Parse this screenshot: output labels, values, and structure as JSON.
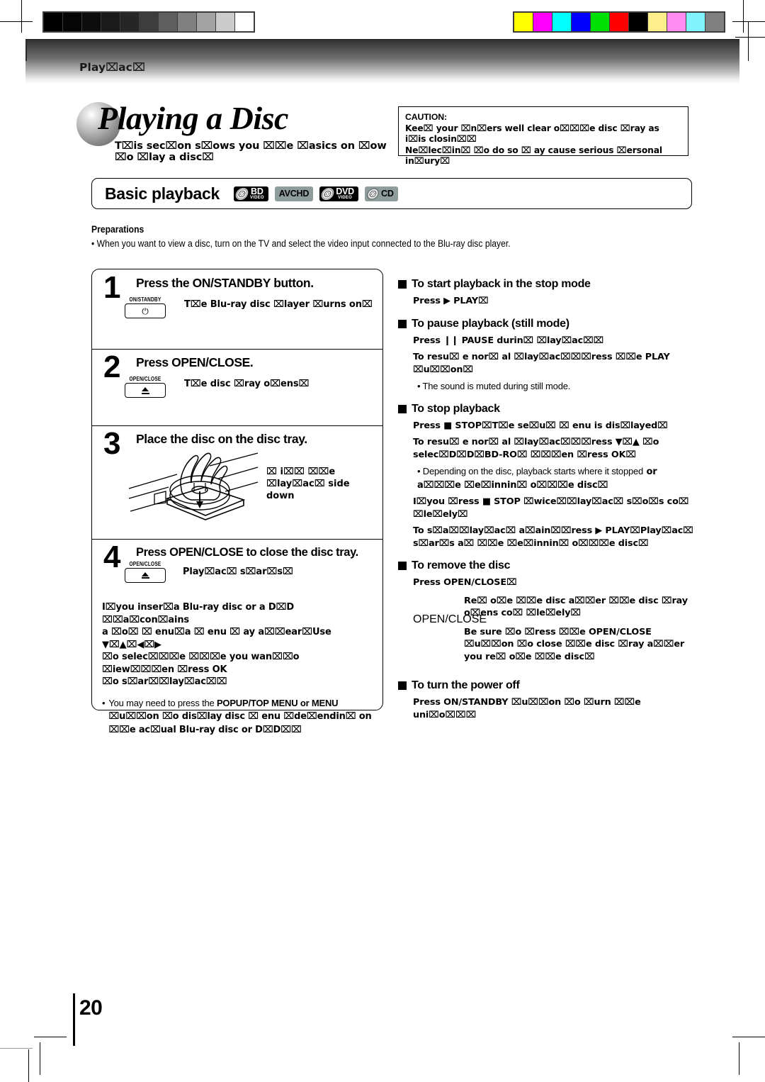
{
  "document": {
    "page_number": "20",
    "running_head": "Play⌧ac⌧"
  },
  "calibration": {
    "grayscale_patches": [
      "#000000",
      "#050505",
      "#0d0d0d",
      "#1a1a1a",
      "#262626",
      "#3d3d3d",
      "#5e5e5e",
      "#808080",
      "#a3a3a3",
      "#cccccc",
      "#ffffff"
    ],
    "color_patches": [
      "#ffff00",
      "#ff00ff",
      "#00ffff",
      "#0000ff",
      "#00e000",
      "#ff0000",
      "#000000",
      "#ffef8a",
      "#ff8cf0",
      "#80f5ff",
      "#808080"
    ]
  },
  "title": {
    "main": "Playing a Disc",
    "subtitle": "T⌧is sec⌧on s⌧ows you ⌧⌧e ⌧asics on ⌧ow ⌧o ⌧lay a disc⌧"
  },
  "caution": {
    "label": "CAUTION:",
    "line1": "Kee⌧ your ⌧n⌧ers well clear o⌧⌧⌧e disc ⌧ray as i⌧is closin⌧⌧",
    "line2": "Ne⌧lec⌧in⌧ ⌧o do so ⌧ ay cause serious ⌧ersonal in⌧ury⌧"
  },
  "banner": {
    "title": "Basic playback",
    "badges": [
      {
        "type": "disc",
        "name": "BD",
        "sub": "Video",
        "style": "dark"
      },
      {
        "type": "flat",
        "name": "AVCHD",
        "sub": "",
        "style": "gray"
      },
      {
        "type": "disc",
        "name": "DVD",
        "sub": "Video",
        "style": "dark"
      },
      {
        "type": "disc",
        "name": "CD",
        "sub": "",
        "style": "gray"
      }
    ]
  },
  "preparations": {
    "heading": "Preparations",
    "bullet": "• When you want to view a disc, turn on the TV and select the video input connected to the Blu-ray disc player."
  },
  "steps": [
    {
      "number": "1",
      "heading": "Press the ON/STANDBY button.",
      "key_label": "ON/STANDBY",
      "key_icon": "power-icon",
      "text": "T⌧e Blu-ray disc ⌧layer ⌧urns on⌧"
    },
    {
      "number": "2",
      "heading": "Press OPEN/CLOSE.",
      "key_label": "OPEN/CLOSE",
      "key_icon": "eject-icon",
      "text": "T⌧e disc ⌧ray o⌧ens⌧"
    },
    {
      "number": "3",
      "heading": "Place the disc on the disc tray.",
      "figure": "hand-placing-disc-on-tray-illustration",
      "fig_line1": "⌧ i⌧⌧ ⌧⌧e ⌧lay⌧ac⌧ side",
      "fig_line2": "down"
    },
    {
      "number": "4",
      "heading": "Press OPEN/CLOSE to close the disc tray.",
      "key_label": "OPEN/CLOSE",
      "key_icon": "eject-icon",
      "text": "Play⌧ac⌧ s⌧ar⌧s⌧",
      "note_line1": "I⌧you inser⌧a Blu-ray disc or a D⌧D ⌧⌧a⌧con⌧ains",
      "note_line2": "a ⌧o⌧ ⌧ enu⌧a ⌧ enu ⌧ ay a⌧⌧ear⌧Use",
      "note_arrows": "▼⌧▲⌧◀⌧▶",
      "note_line3": "⌧o selec⌧⌧⌧e ⌧⌧⌧e you wan⌧⌧o ⌧iew⌧⌧⌧en ⌧ress OK",
      "note_line4": "⌧o s⌧ar⌧⌧lay⌧ac⌧⌧",
      "bullet_a": "You may need to press the ",
      "bullet_b": "POPUP/TOP MENU or MENU",
      "bullet_c": " ⌧u⌧⌧on ⌧o dis⌧lay disc ⌧ enu ⌧de⌧endin⌧ on ⌧⌧e ac⌧ual Blu-ray disc or D⌧D⌧⌧"
    }
  ],
  "right_sections": [
    {
      "heading": "To start playback in the stop mode",
      "lines": [
        {
          "kind": "bold",
          "text": "Press  ▶ PLAY⌧"
        }
      ]
    },
    {
      "heading": "To pause playback (still mode)",
      "lines": [
        {
          "kind": "bold",
          "text": "Press  ❙❙ PAUSE durin⌧ ⌧lay⌧ac⌧⌧"
        },
        {
          "kind": "bold",
          "text": "To resu⌧ e nor⌧ al ⌧lay⌧ac⌧⌧⌧ress ⌧⌧e PLAY ⌧u⌧⌧on⌧"
        },
        {
          "kind": "bullet",
          "text": "• The sound is muted during still mode."
        }
      ]
    },
    {
      "heading": "To stop playback",
      "lines": [
        {
          "kind": "bold",
          "text": "Press  ■ STOP⌧T⌧e se⌧u⌧ ⌧ enu is dis⌧layed⌧"
        },
        {
          "kind": "bold",
          "text": "To resu⌧ e nor⌧ al ⌧lay⌧ac⌧⌧⌧ress  ▼⌧▲ ⌧o selec⌧D⌧D⌧BD-RO⌧ ⌧⌧⌧en ⌧ress OK⌧"
        },
        {
          "kind": "bullet-mixed",
          "normal": "• Depending on the disc, playback starts where it stopped",
          "bold": "or a⌧⌧⌧e ⌧e⌧innin⌧ o⌧⌧⌧e disc⌧"
        },
        {
          "kind": "bold",
          "text": "I⌧you ⌧ress  ■ STOP ⌧wice⌧⌧lay⌧ac⌧ s⌧o⌧s co⌧ ⌧le⌧ely⌧"
        },
        {
          "kind": "bold",
          "text": "To s⌧a⌧⌧lay⌧ac⌧ a⌧ain⌧⌧ress ▶ PLAY⌧Play⌧ac⌧ s⌧ar⌧s a⌧ ⌧⌧e ⌧e⌧innin⌧ o⌧⌧⌧e disc⌧"
        }
      ]
    },
    {
      "heading": "To remove the disc",
      "press_line": "Press OPEN/CLOSE⌧",
      "key_label": "OPEN/CLOSE",
      "key_icon": "eject-icon",
      "para1": "Re⌧ o⌧e ⌧⌧e disc a⌧⌧er ⌧⌧e disc ⌧ray o⌧ens co⌧ ⌧le⌧ely⌧",
      "para2": "Be sure ⌧o ⌧ress ⌧⌧e  OPEN/CLOSE ⌧u⌧⌧on ⌧o  close  ⌧⌧e  disc  ⌧ray  a⌧⌧er  you  re⌧ o⌧e ⌧⌧e disc⌧"
    },
    {
      "heading": "To turn the power off",
      "lines": [
        {
          "kind": "bold",
          "text": "Press ON/STANDBY ⌧u⌧⌧on ⌧o ⌧urn ⌧⌧e uni⌧o⌧⌧⌧"
        }
      ]
    }
  ]
}
